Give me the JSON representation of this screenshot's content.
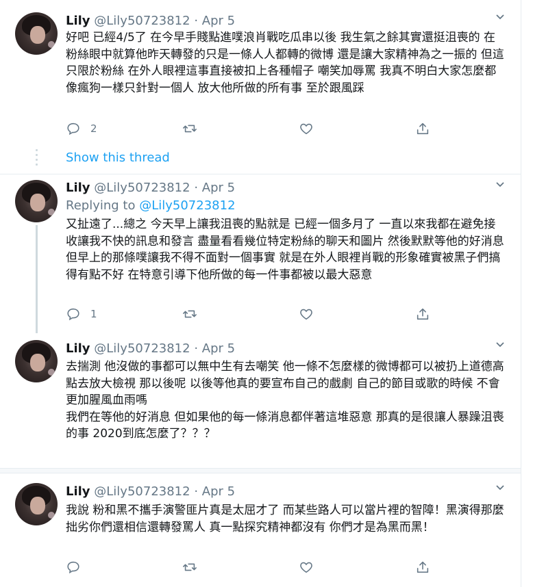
{
  "tweets": [
    {
      "name": "Lily",
      "handle": "@Lily50723812",
      "sep": "·",
      "date": "Apr 5",
      "text": "好吧 已經4/5了 在今早手賤點進噗浪肖戰吃瓜串以後 我生氣之餘其實還挺沮喪的 在粉絲眼中就算他昨天轉發的只是一條人人都轉的微博 還是讓大家精神為之一振的 但這只限於粉絲 在外人眼裡這事直接被扣上各種帽子 嘲笑加辱罵 我真不明白大家怎麼都像瘋狗一樣只針對一個人 放大他所做的所有事 至於跟風踩",
      "reply_count": "2"
    },
    {
      "name": "Lily",
      "handle": "@Lily50723812",
      "sep": "·",
      "date": "Apr 5",
      "replying_prefix": "Replying to",
      "replying_handle": "@Lily50723812",
      "text": "又扯遠了...總之 今天早上讓我沮喪的點就是 已經一個多月了 一直以來我都在避免接收讓我不快的訊息和發言 盡量看看幾位特定粉絲的聊天和圖片 然後默默等他的好消息 但早上的那條噗讓我不得不面對一個事實 就是在外人眼裡肖戰的形象確實被黑子們搞得有點不好 在特意引導下他所做的每一件事都被以最大惡意",
      "reply_count": "1"
    },
    {
      "name": "Lily",
      "handle": "@Lily50723812",
      "sep": "·",
      "date": "Apr 5",
      "text": "去揣測 他沒做的事都可以無中生有去嘲笑 他一條不怎麼樣的微博都可以被扔上道德高點去放大檢視 那以後呢 以後等他真的要宣布自己的戲劇 自己的節目或歌的時候 不會更加腥風血雨嗎\n我們在等他的好消息 但如果他的每一條消息都伴著這堆惡意 那真的是很讓人暴躁沮喪的事 2020到底怎麼了？？？",
      "reply_count": ""
    },
    {
      "name": "Lily",
      "handle": "@Lily50723812",
      "sep": "·",
      "date": "Apr 5",
      "text": "我說 粉和黑不攜手演警匪片真是太屈才了 而某些路人可以當片裡的智障！黑演得那麼拙劣你們還相信還轉發罵人 真一點探究精神都沒有 你們才是為黑而黑！",
      "reply_count": ""
    }
  ],
  "show_thread": "Show this thread",
  "icons": {
    "reply": "reply-icon",
    "retweet": "retweet-icon",
    "like": "like-icon",
    "share": "share-icon",
    "caret": "chevron-down-icon"
  },
  "colors": {
    "link": "#1da1f2",
    "muted": "#657786",
    "text": "#14171a"
  }
}
